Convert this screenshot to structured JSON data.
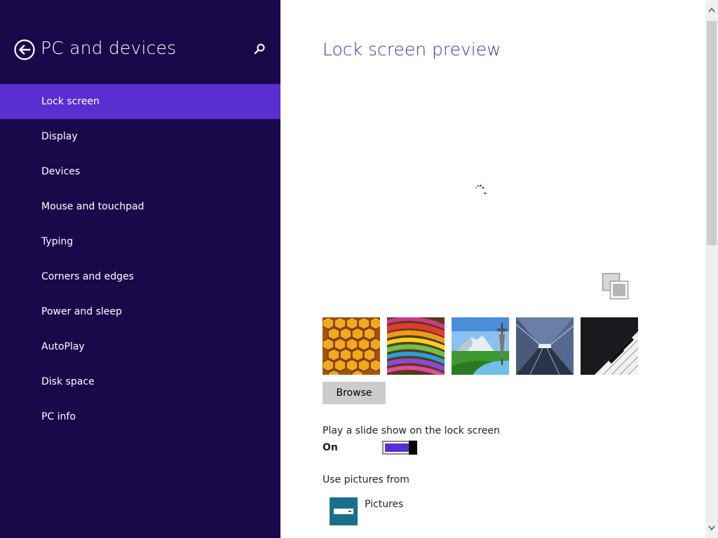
{
  "sidebar": {
    "title": "PC and devices",
    "back_icon": "back-arrow-icon",
    "search_icon": "search-icon",
    "items": [
      {
        "label": "Lock screen",
        "active": true
      },
      {
        "label": "Display"
      },
      {
        "label": "Devices"
      },
      {
        "label": "Mouse and touchpad"
      },
      {
        "label": "Typing"
      },
      {
        "label": "Corners and edges"
      },
      {
        "label": "Power and sleep"
      },
      {
        "label": "AutoPlay"
      },
      {
        "label": "Disk space"
      },
      {
        "label": "PC info"
      }
    ]
  },
  "main": {
    "title": "Lock screen preview",
    "browse_label": "Browse",
    "slideshow": {
      "label": "Play a slide show on the lock screen",
      "state": "On",
      "enabled": true
    },
    "use_pictures_label": "Use pictures from",
    "source": {
      "name": "Pictures",
      "icon": "pictures-library-icon"
    }
  },
  "colors": {
    "sidebar_bg": "#180a4a",
    "accent": "#5a2ecf",
    "title": "#4d2fa6",
    "source_tile": "#1a6e8c"
  }
}
